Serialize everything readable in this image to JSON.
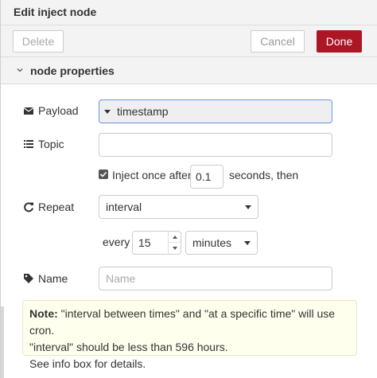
{
  "header": {
    "title": "Edit inject node"
  },
  "toolbar": {
    "delete_label": "Delete",
    "cancel_label": "Cancel",
    "done_label": "Done"
  },
  "section": {
    "title": "node properties"
  },
  "payload": {
    "label": "Payload",
    "value": "timestamp"
  },
  "topic": {
    "label": "Topic",
    "value": ""
  },
  "inject_once": {
    "checked": true,
    "label": "Inject once after",
    "delay": "0.1",
    "suffix": "seconds, then"
  },
  "repeat": {
    "label": "Repeat",
    "mode": "interval",
    "every_label": "every",
    "every_value": "15",
    "unit": "minutes"
  },
  "name": {
    "label": "Name",
    "placeholder": "Name",
    "value": ""
  },
  "note": {
    "bold": "Note:",
    "line1": " \"interval between times\" and \"at a specific time\" will use cron.",
    "line2": "\"interval\" should be less than 596 hours.",
    "line3": "See info box for details."
  },
  "colors": {
    "done_button": "#ad1625",
    "note_background": "#ffffee",
    "focus_border": "#6495ed"
  }
}
